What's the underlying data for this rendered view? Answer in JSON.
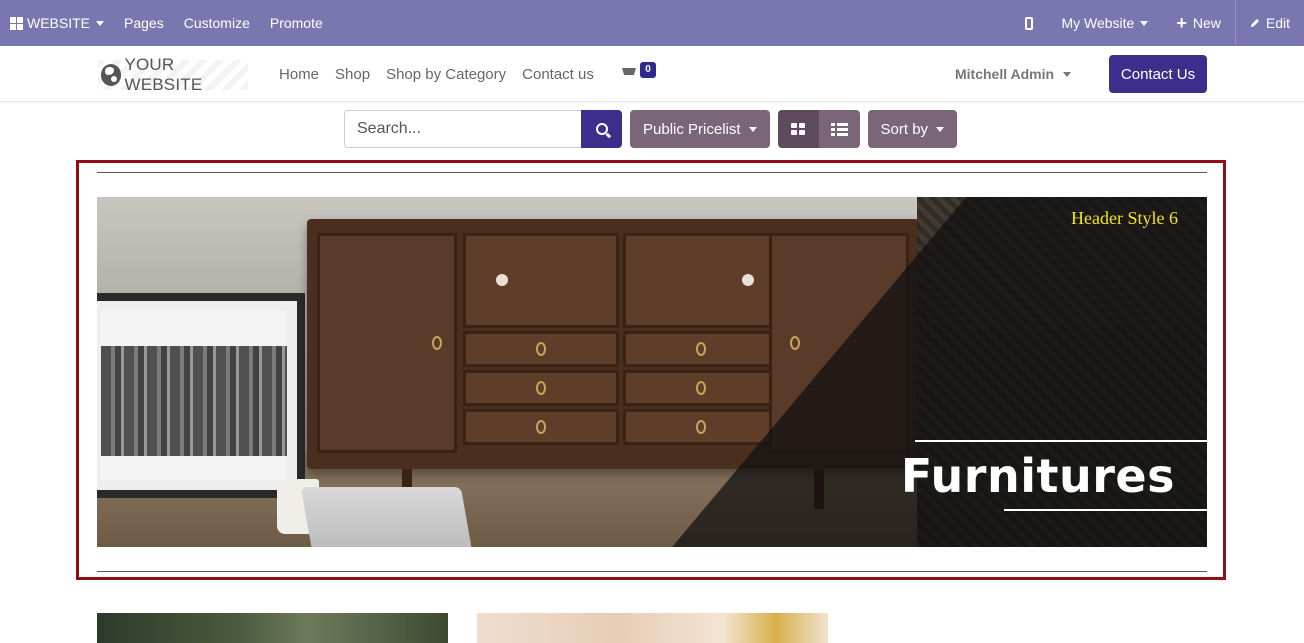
{
  "topbar": {
    "apps_label": "WEBSITE",
    "menu": [
      "Pages",
      "Customize",
      "Promote"
    ],
    "my_website": "My Website",
    "new_label": "New",
    "edit_label": "Edit"
  },
  "header": {
    "logo_text": "YOUR WEBSITE",
    "nav": [
      "Home",
      "Shop",
      "Shop by Category",
      "Contact us"
    ],
    "cart_count": "0",
    "user_name": "Mitchell Admin",
    "contact_button": "Contact Us"
  },
  "toolbar": {
    "search_placeholder": "Search...",
    "pricelist_label": "Public Pricelist",
    "sort_label": "Sort by"
  },
  "banner": {
    "style_label": "Header Style 6",
    "title": "Furnitures"
  },
  "colors": {
    "topbar": "#7a77b0",
    "primary": "#3c2f8c",
    "secondary": "#7b6579",
    "frame_border": "#8b0f14",
    "style_label": "#f3e51a"
  },
  "icons": [
    "apps-grid-icon",
    "mobile-icon",
    "plus-icon",
    "pencil-icon",
    "globe-icon",
    "cart-icon",
    "search-icon",
    "grid-view-icon",
    "list-view-icon"
  ]
}
